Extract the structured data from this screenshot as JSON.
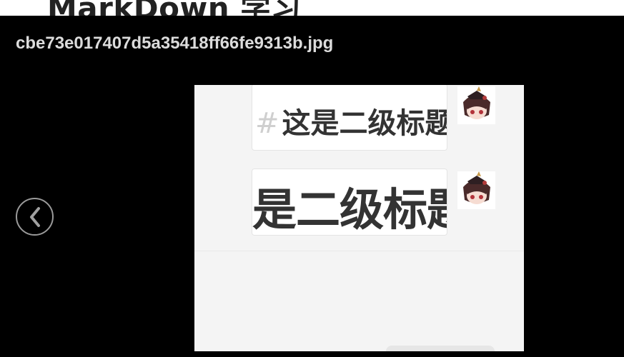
{
  "page": {
    "heading": "MarkDown 学习"
  },
  "viewer": {
    "filename": "cbe73e017407d5a35418ff66fe9313b.jpg",
    "prev_icon": "chevron-left-icon"
  },
  "image": {
    "bubbles": [
      {
        "hash": "#",
        "text": "这是二级标题"
      },
      {
        "text": "是二级标题"
      }
    ],
    "avatar_icon": "anime-avatar-icon"
  }
}
